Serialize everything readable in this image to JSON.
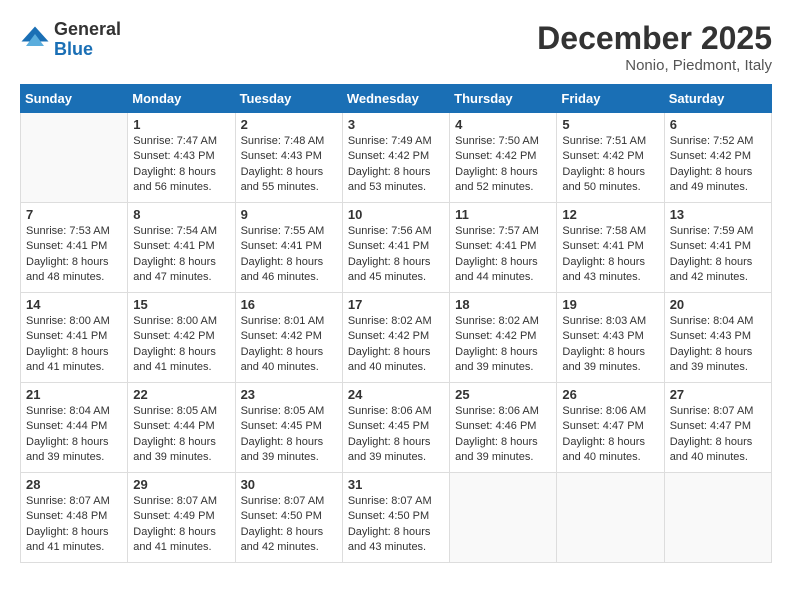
{
  "header": {
    "logo_general": "General",
    "logo_blue": "Blue",
    "month_title": "December 2025",
    "location": "Nonio, Piedmont, Italy"
  },
  "weekdays": [
    "Sunday",
    "Monday",
    "Tuesday",
    "Wednesday",
    "Thursday",
    "Friday",
    "Saturday"
  ],
  "weeks": [
    [
      {
        "day": "",
        "content": ""
      },
      {
        "day": "1",
        "content": "Sunrise: 7:47 AM\nSunset: 4:43 PM\nDaylight: 8 hours\nand 56 minutes."
      },
      {
        "day": "2",
        "content": "Sunrise: 7:48 AM\nSunset: 4:43 PM\nDaylight: 8 hours\nand 55 minutes."
      },
      {
        "day": "3",
        "content": "Sunrise: 7:49 AM\nSunset: 4:42 PM\nDaylight: 8 hours\nand 53 minutes."
      },
      {
        "day": "4",
        "content": "Sunrise: 7:50 AM\nSunset: 4:42 PM\nDaylight: 8 hours\nand 52 minutes."
      },
      {
        "day": "5",
        "content": "Sunrise: 7:51 AM\nSunset: 4:42 PM\nDaylight: 8 hours\nand 50 minutes."
      },
      {
        "day": "6",
        "content": "Sunrise: 7:52 AM\nSunset: 4:42 PM\nDaylight: 8 hours\nand 49 minutes."
      }
    ],
    [
      {
        "day": "7",
        "content": "Sunrise: 7:53 AM\nSunset: 4:41 PM\nDaylight: 8 hours\nand 48 minutes."
      },
      {
        "day": "8",
        "content": "Sunrise: 7:54 AM\nSunset: 4:41 PM\nDaylight: 8 hours\nand 47 minutes."
      },
      {
        "day": "9",
        "content": "Sunrise: 7:55 AM\nSunset: 4:41 PM\nDaylight: 8 hours\nand 46 minutes."
      },
      {
        "day": "10",
        "content": "Sunrise: 7:56 AM\nSunset: 4:41 PM\nDaylight: 8 hours\nand 45 minutes."
      },
      {
        "day": "11",
        "content": "Sunrise: 7:57 AM\nSunset: 4:41 PM\nDaylight: 8 hours\nand 44 minutes."
      },
      {
        "day": "12",
        "content": "Sunrise: 7:58 AM\nSunset: 4:41 PM\nDaylight: 8 hours\nand 43 minutes."
      },
      {
        "day": "13",
        "content": "Sunrise: 7:59 AM\nSunset: 4:41 PM\nDaylight: 8 hours\nand 42 minutes."
      }
    ],
    [
      {
        "day": "14",
        "content": "Sunrise: 8:00 AM\nSunset: 4:41 PM\nDaylight: 8 hours\nand 41 minutes."
      },
      {
        "day": "15",
        "content": "Sunrise: 8:00 AM\nSunset: 4:42 PM\nDaylight: 8 hours\nand 41 minutes."
      },
      {
        "day": "16",
        "content": "Sunrise: 8:01 AM\nSunset: 4:42 PM\nDaylight: 8 hours\nand 40 minutes."
      },
      {
        "day": "17",
        "content": "Sunrise: 8:02 AM\nSunset: 4:42 PM\nDaylight: 8 hours\nand 40 minutes."
      },
      {
        "day": "18",
        "content": "Sunrise: 8:02 AM\nSunset: 4:42 PM\nDaylight: 8 hours\nand 39 minutes."
      },
      {
        "day": "19",
        "content": "Sunrise: 8:03 AM\nSunset: 4:43 PM\nDaylight: 8 hours\nand 39 minutes."
      },
      {
        "day": "20",
        "content": "Sunrise: 8:04 AM\nSunset: 4:43 PM\nDaylight: 8 hours\nand 39 minutes."
      }
    ],
    [
      {
        "day": "21",
        "content": "Sunrise: 8:04 AM\nSunset: 4:44 PM\nDaylight: 8 hours\nand 39 minutes."
      },
      {
        "day": "22",
        "content": "Sunrise: 8:05 AM\nSunset: 4:44 PM\nDaylight: 8 hours\nand 39 minutes."
      },
      {
        "day": "23",
        "content": "Sunrise: 8:05 AM\nSunset: 4:45 PM\nDaylight: 8 hours\nand 39 minutes."
      },
      {
        "day": "24",
        "content": "Sunrise: 8:06 AM\nSunset: 4:45 PM\nDaylight: 8 hours\nand 39 minutes."
      },
      {
        "day": "25",
        "content": "Sunrise: 8:06 AM\nSunset: 4:46 PM\nDaylight: 8 hours\nand 39 minutes."
      },
      {
        "day": "26",
        "content": "Sunrise: 8:06 AM\nSunset: 4:47 PM\nDaylight: 8 hours\nand 40 minutes."
      },
      {
        "day": "27",
        "content": "Sunrise: 8:07 AM\nSunset: 4:47 PM\nDaylight: 8 hours\nand 40 minutes."
      }
    ],
    [
      {
        "day": "28",
        "content": "Sunrise: 8:07 AM\nSunset: 4:48 PM\nDaylight: 8 hours\nand 41 minutes."
      },
      {
        "day": "29",
        "content": "Sunrise: 8:07 AM\nSunset: 4:49 PM\nDaylight: 8 hours\nand 41 minutes."
      },
      {
        "day": "30",
        "content": "Sunrise: 8:07 AM\nSunset: 4:50 PM\nDaylight: 8 hours\nand 42 minutes."
      },
      {
        "day": "31",
        "content": "Sunrise: 8:07 AM\nSunset: 4:50 PM\nDaylight: 8 hours\nand 43 minutes."
      },
      {
        "day": "",
        "content": ""
      },
      {
        "day": "",
        "content": ""
      },
      {
        "day": "",
        "content": ""
      }
    ]
  ]
}
